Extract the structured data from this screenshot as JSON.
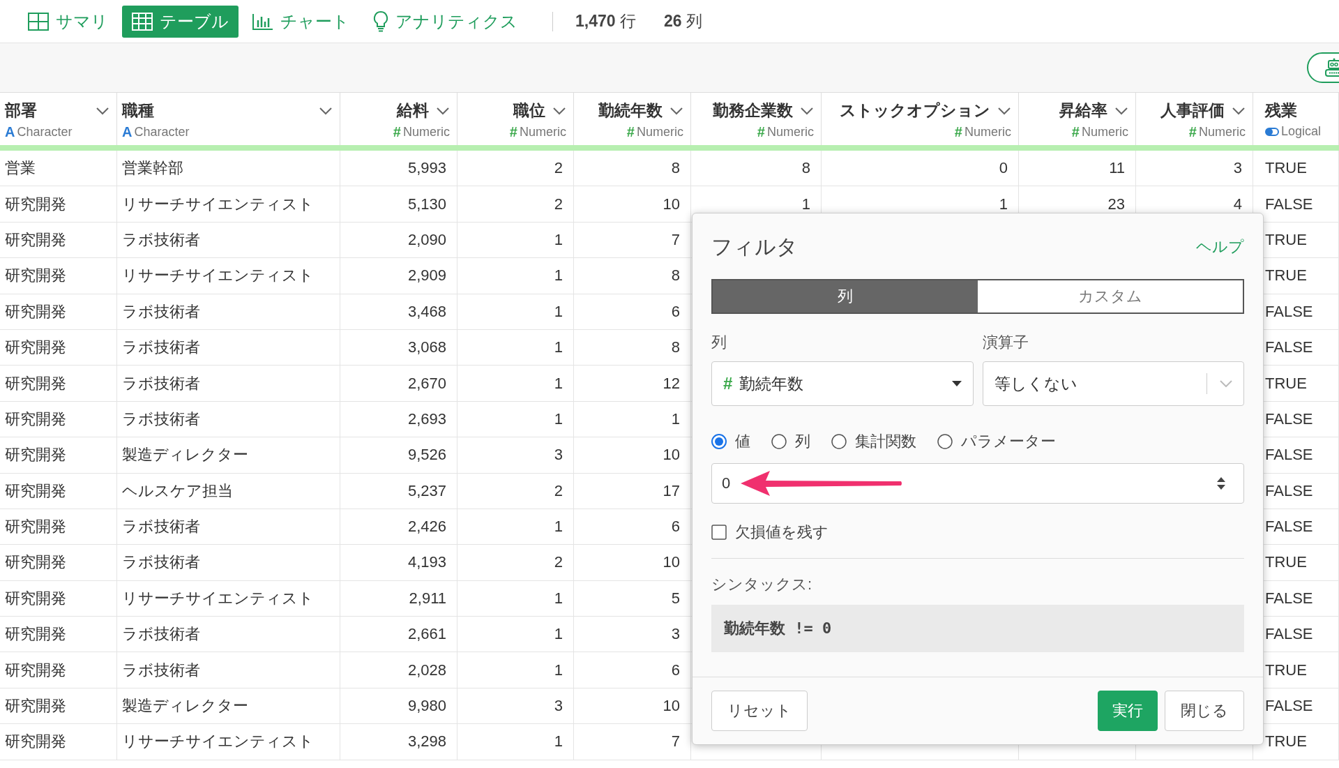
{
  "top_tabs": [
    {
      "label": "サマリ",
      "kind": "summary",
      "selected": false
    },
    {
      "label": "テーブル",
      "kind": "table",
      "selected": true
    },
    {
      "label": "チャート",
      "kind": "chart",
      "selected": false
    },
    {
      "label": "アナリティクス",
      "kind": "analytics",
      "selected": false
    }
  ],
  "counts": [
    "**1,470** 行",
    "**26** 列"
  ],
  "table": {
    "columns": [
      {
        "name": "部署",
        "type": "Character",
        "kind": "character",
        "icon": "A"
      },
      {
        "name": "職種",
        "type": "Character",
        "kind": "character",
        "icon": "A"
      },
      {
        "name": "給料",
        "type": "Numeric",
        "kind": "numeric",
        "icon": "#"
      },
      {
        "name": "職位",
        "type": "Numeric",
        "kind": "numeric",
        "icon": "#"
      },
      {
        "name": "勤続年数",
        "type": "Numeric",
        "kind": "numeric",
        "icon": "#"
      },
      {
        "name": "勤務企業数",
        "type": "Numeric",
        "kind": "numeric",
        "icon": "#"
      },
      {
        "name": "ストックオプション",
        "type": "Numeric",
        "kind": "numeric",
        "icon": "#"
      },
      {
        "name": "昇給率",
        "type": "Numeric",
        "kind": "numeric",
        "icon": "#"
      },
      {
        "name": "人事評価",
        "type": "Numeric",
        "kind": "numeric",
        "icon": "#"
      },
      {
        "name": "残業",
        "type": "Logical",
        "kind": "logical"
      }
    ],
    "rows": [
      [
        "営業",
        "営業幹部",
        "5,993",
        "2",
        "8",
        "8",
        "0",
        "11",
        "3",
        "TRUE"
      ],
      [
        "研究開発",
        "リサーチサイエンティスト",
        "5,130",
        "2",
        "10",
        "1",
        "1",
        "23",
        "4",
        "FALSE"
      ],
      [
        "研究開発",
        "ラボ技術者",
        "2,090",
        "1",
        "7",
        null,
        null,
        null,
        null,
        "TRUE"
      ],
      [
        "研究開発",
        "リサーチサイエンティスト",
        "2,909",
        "1",
        "8",
        null,
        null,
        null,
        null,
        "TRUE"
      ],
      [
        "研究開発",
        "ラボ技術者",
        "3,468",
        "1",
        "6",
        null,
        null,
        null,
        null,
        "FALSE"
      ],
      [
        "研究開発",
        "ラボ技術者",
        "3,068",
        "1",
        "8",
        null,
        null,
        null,
        null,
        "FALSE"
      ],
      [
        "研究開発",
        "ラボ技術者",
        "2,670",
        "1",
        "12",
        null,
        null,
        null,
        null,
        "TRUE"
      ],
      [
        "研究開発",
        "ラボ技術者",
        "2,693",
        "1",
        "1",
        null,
        null,
        null,
        null,
        "FALSE"
      ],
      [
        "研究開発",
        "製造ディレクター",
        "9,526",
        "3",
        "10",
        null,
        null,
        null,
        null,
        "FALSE"
      ],
      [
        "研究開発",
        "ヘルスケア担当",
        "5,237",
        "2",
        "17",
        null,
        null,
        null,
        null,
        "FALSE"
      ],
      [
        "研究開発",
        "ラボ技術者",
        "2,426",
        "1",
        "6",
        null,
        null,
        null,
        null,
        "FALSE"
      ],
      [
        "研究開発",
        "ラボ技術者",
        "4,193",
        "2",
        "10",
        null,
        null,
        null,
        null,
        "TRUE"
      ],
      [
        "研究開発",
        "リサーチサイエンティスト",
        "2,911",
        "1",
        "5",
        null,
        null,
        null,
        null,
        "FALSE"
      ],
      [
        "研究開発",
        "ラボ技術者",
        "2,661",
        "1",
        "3",
        null,
        null,
        null,
        null,
        "FALSE"
      ],
      [
        "研究開発",
        "ラボ技術者",
        "2,028",
        "1",
        "6",
        null,
        null,
        null,
        null,
        "TRUE"
      ],
      [
        "研究開発",
        "製造ディレクター",
        "9,980",
        "3",
        "10",
        null,
        null,
        null,
        null,
        "FALSE"
      ],
      [
        "研究開発",
        "リサーチサイエンティスト",
        "3,298",
        "1",
        "7",
        null,
        null,
        null,
        null,
        "TRUE"
      ]
    ]
  },
  "filter_dialog": {
    "title": "フィルタ",
    "help_link": "ヘルプ",
    "mode_tabs": [
      {
        "label": "列",
        "selected": true
      },
      {
        "label": "カスタム",
        "selected": false
      }
    ],
    "column_label": "列",
    "column_select": {
      "icon": "#",
      "value": "勤続年数"
    },
    "operator_label": "演算子",
    "operator_select": {
      "value": "等しくない"
    },
    "value_types": [
      {
        "label": "値",
        "selected": true
      },
      {
        "label": "列",
        "selected": false
      },
      {
        "label": "集計関数",
        "selected": false
      },
      {
        "label": "パラメーター",
        "selected": false
      }
    ],
    "value_input": {
      "value": "0"
    },
    "keep_missing": {
      "label": "欠損値を残す",
      "checked": false
    },
    "syntax_label": "シンタックス:",
    "syntax": "勤続年数 != 0",
    "buttons": [
      {
        "label": "リセット",
        "kind": "secondary"
      },
      {
        "label": "実行",
        "kind": "primary"
      },
      {
        "label": "閉じる",
        "kind": "secondary"
      }
    ]
  }
}
